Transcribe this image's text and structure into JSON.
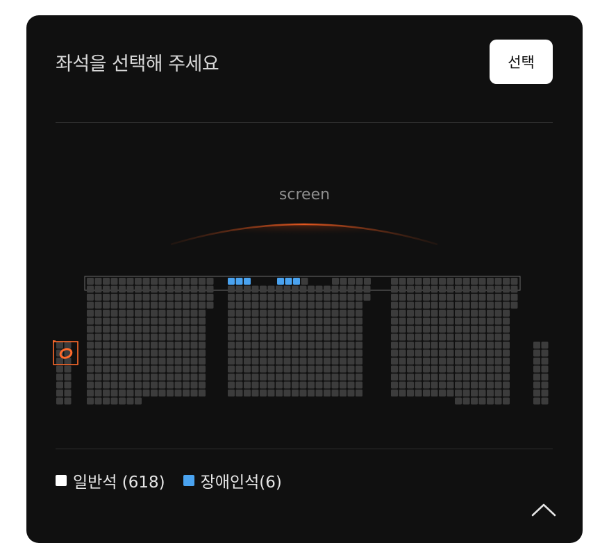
{
  "header": {
    "title": "좌석을 선택해 주세요",
    "select_button": "선택"
  },
  "screen": {
    "label": "screen"
  },
  "legend": {
    "general_label": "일반석 (618)",
    "accessible_label": "장애인석(6)"
  },
  "colors": {
    "background": "#101010",
    "seat": "#3c3c3c",
    "accessible_seat": "#4aa3f0",
    "general_swatch": "#ffffff",
    "marker": "#ff6a2b",
    "screen_glow": "#e2561f"
  },
  "icons": {
    "collapse": "chevron-up-icon",
    "selection_marker": "hand-drawn-circle-marker-icon"
  }
}
